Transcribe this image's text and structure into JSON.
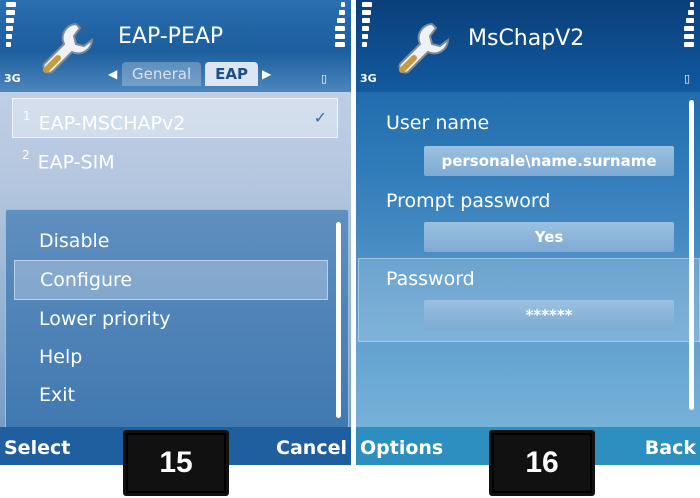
{
  "screen1": {
    "network": "3G",
    "title": "EAP-PEAP",
    "tabs": [
      "General",
      "EAP"
    ],
    "active_tab": "EAP",
    "list": [
      {
        "index": "1",
        "label": "EAP-MSCHAPv2",
        "checked": true
      },
      {
        "index": "2",
        "label": "EAP-SIM",
        "checked": false
      }
    ],
    "menu": [
      "Disable",
      "Configure",
      "Lower priority",
      "Help",
      "Exit"
    ],
    "selected_menu_item": "Configure",
    "left_softkey": "Select",
    "right_softkey": "Cancel",
    "step": "15"
  },
  "screen2": {
    "network": "3G",
    "title": "MsChapV2",
    "fields": [
      {
        "label": "User name",
        "value": "personale\\name.surname"
      },
      {
        "label": "Prompt password",
        "value": "Yes"
      },
      {
        "label": "Password",
        "value": "******"
      }
    ],
    "selected_field": "Password",
    "left_softkey": "Options",
    "right_softkey": "Back",
    "step": "16"
  },
  "colors": {
    "header_blue": "#1c5e9e",
    "popup_blue": "#3f78b0"
  },
  "icons": [
    "signal-icon",
    "battery-icon",
    "wrench-settings-icon",
    "checkmark-icon",
    "lock-icon"
  ]
}
